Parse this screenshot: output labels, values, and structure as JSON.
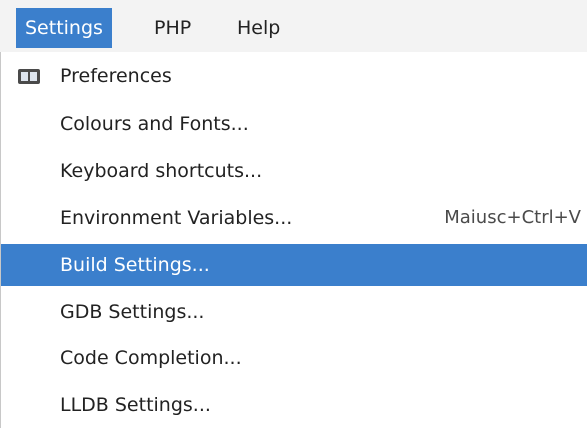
{
  "menubar": {
    "items": [
      {
        "label": "Settings"
      },
      {
        "label": "PHP"
      },
      {
        "label": "Help"
      }
    ]
  },
  "menu": {
    "items": [
      {
        "label": "Preferences",
        "icon": "preferences-icon"
      },
      {
        "label": "Colours and Fonts..."
      },
      {
        "label": "Keyboard shortcuts..."
      },
      {
        "label": "Environment Variables...",
        "shortcut": "Maiusc+Ctrl+V"
      },
      {
        "label": "Build Settings..."
      },
      {
        "label": "GDB Settings..."
      },
      {
        "label": "Code Completion..."
      },
      {
        "label": "LLDB Settings..."
      }
    ]
  },
  "colors": {
    "highlight": "#3b7fcc",
    "text": "#222222",
    "menubar_bg": "#f3f3f3"
  }
}
